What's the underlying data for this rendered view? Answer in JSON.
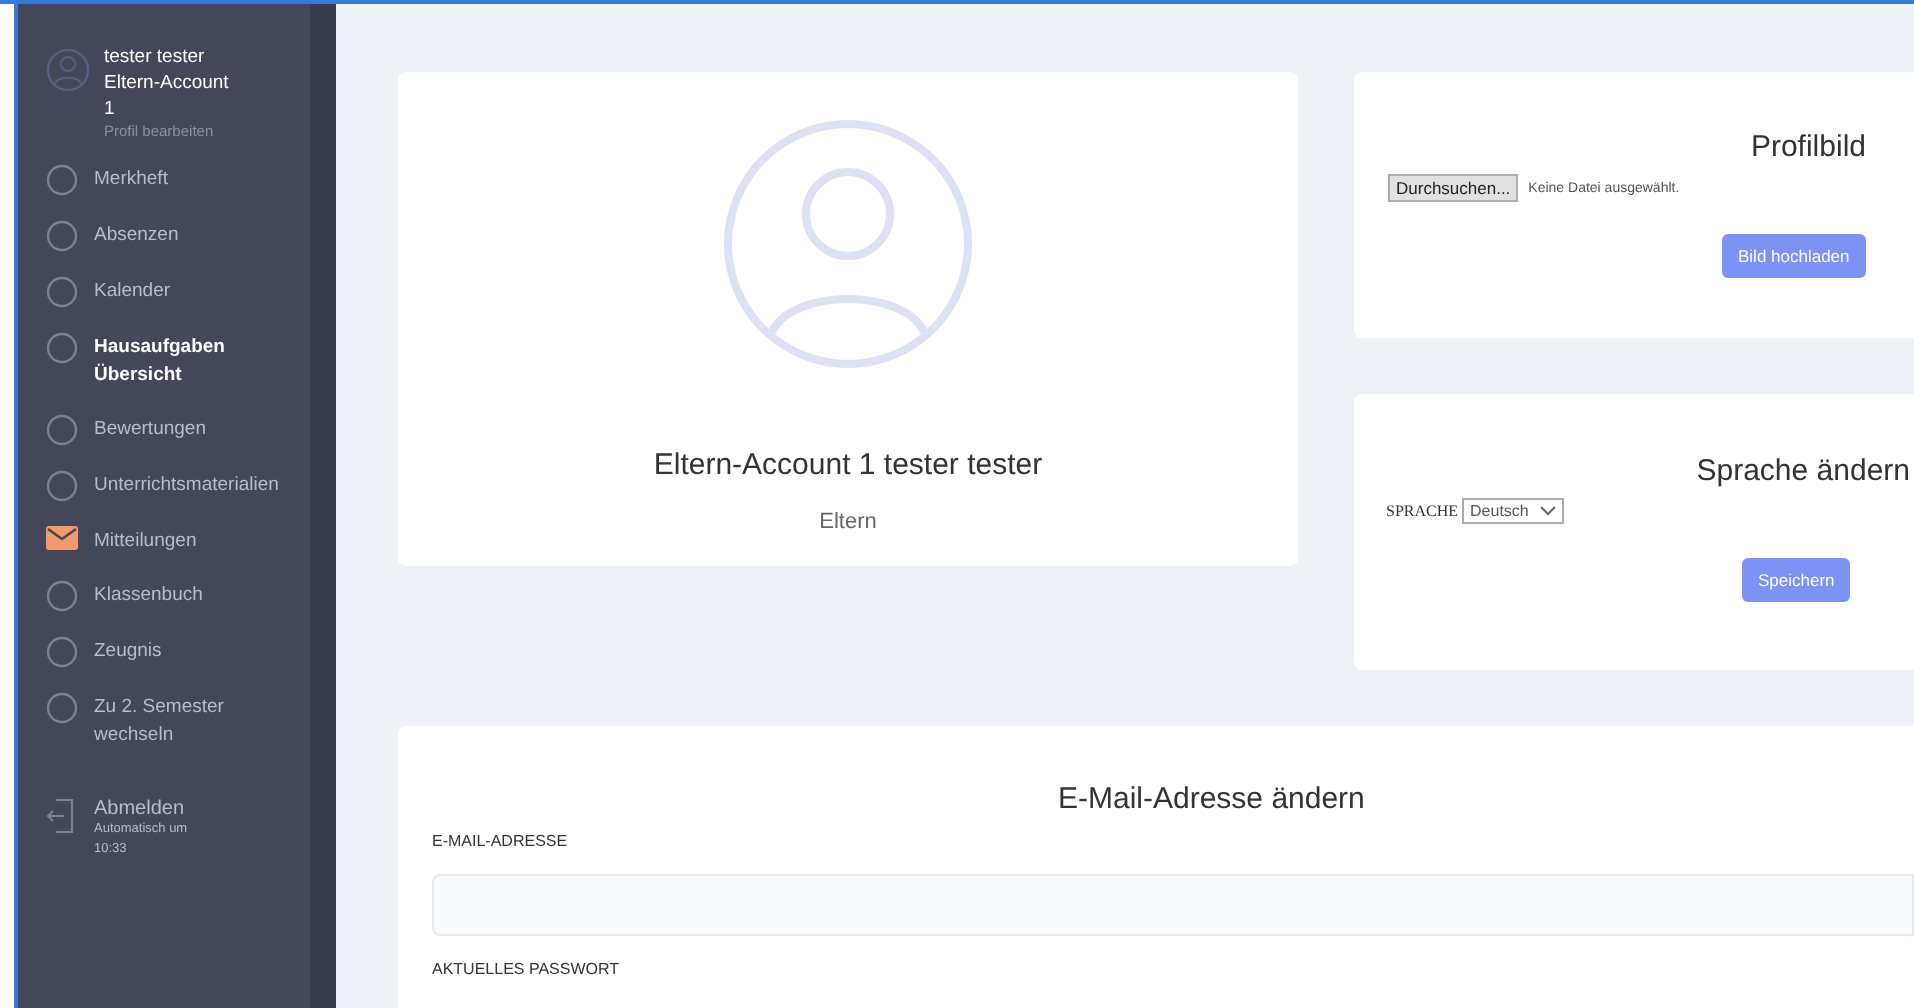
{
  "user": {
    "name": "tester tester",
    "account": "Eltern-Account 1",
    "edit_link": "Profil bearbeiten"
  },
  "nav": [
    {
      "label": "Merkheft",
      "kind": "circle",
      "selected": false
    },
    {
      "label": "Absenzen",
      "kind": "circle",
      "selected": false
    },
    {
      "label": "Kalender",
      "kind": "circle",
      "selected": false
    },
    {
      "label": "Hausaufgaben Übersicht",
      "kind": "circle",
      "selected": true
    },
    {
      "label": "Bewertungen",
      "kind": "circle",
      "selected": false
    },
    {
      "label": "Unterrichtsmaterialien",
      "kind": "circle",
      "selected": false
    },
    {
      "label": "Mitteilungen",
      "kind": "envelope",
      "selected": false
    },
    {
      "label": "Klassenbuch",
      "kind": "circle",
      "selected": false
    },
    {
      "label": "Zeugnis",
      "kind": "circle",
      "selected": false
    },
    {
      "label": "Zu 2. Semester wechseln",
      "kind": "circle",
      "selected": false
    }
  ],
  "logout": {
    "label": "Abmelden",
    "note": "Automatisch um 10:33"
  },
  "profile_card": {
    "name": "Eltern-Account 1 tester tester",
    "role": "Eltern"
  },
  "picture_card": {
    "title": "Profilbild",
    "browse_button": "Durchsuchen...",
    "file_status": "Keine Datei ausgewählt.",
    "upload_button": "Bild hochladen"
  },
  "language_card": {
    "title": "Sprache ändern",
    "label": "SPRACHE",
    "value": "Deutsch",
    "save_button": "Speichern"
  },
  "email_card": {
    "title": "E-Mail-Adresse ändern",
    "email_label": "E-MAIL-ADRESSE",
    "password_label": "AKTUELLES PASSWORT"
  }
}
